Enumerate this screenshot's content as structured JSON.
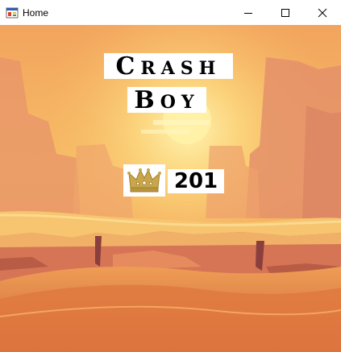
{
  "window": {
    "title": "Home",
    "icons": {
      "app": "app-icon",
      "minimize": "minimize-icon",
      "maximize": "maximize-icon",
      "close": "close-icon"
    }
  },
  "game": {
    "logo_line1": {
      "first": "C",
      "rest": "RASH"
    },
    "logo_line2": {
      "first": "B",
      "rest": "OY"
    },
    "high_score": "201",
    "high_score_icon": "crown-icon",
    "colors": {
      "sky": "#f6b15f",
      "sun": "#fff1a6",
      "sand": "#f7c56f",
      "crown": "#c9a64a"
    }
  }
}
